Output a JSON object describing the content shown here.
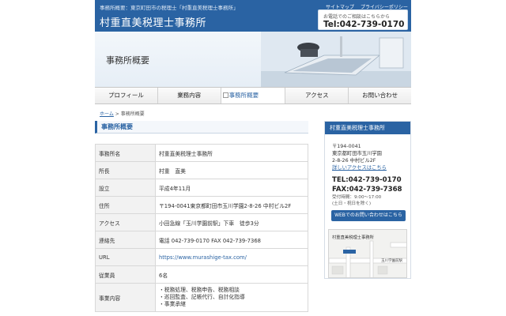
{
  "header": {
    "tagline": "事務所概要：東京町田市の税理士「村重直美税理士事務所」",
    "logo": "村重直美税理士事務所",
    "util_links": [
      "サイトマップ",
      "プライバシーポリシー"
    ],
    "contact_note": "お電話でのご相談はこちらから",
    "contact_tel": "Tel:042-739-0170"
  },
  "banner": {
    "title": "事務所概要"
  },
  "nav": {
    "items": [
      {
        "label": "プロフィール"
      },
      {
        "label": "業務内容"
      },
      {
        "label": "事務所概要"
      },
      {
        "label": "アクセス"
      },
      {
        "label": "お問い合わせ"
      }
    ]
  },
  "breadcrumb": {
    "home": "ホーム",
    "separator": ">",
    "current": "事務所概要"
  },
  "main": {
    "section_title": "事務所概要",
    "rows": [
      {
        "key": "事務所名",
        "value": "村重直美税理士事務所"
      },
      {
        "key": "所長",
        "value": "村重　直美"
      },
      {
        "key": "設立",
        "value": "平成4年11月"
      },
      {
        "key": "住所",
        "value": "〒194-0041東京都町田市玉川学園2-8-26 中村ビル2F"
      },
      {
        "key": "アクセス",
        "value": "小田急線「玉川学園前駅」下車　徒歩3分"
      },
      {
        "key": "連絡先",
        "value": "電話 042-739-0170 FAX 042-739-7368"
      },
      {
        "key": "URL",
        "value": "https://www.murashige-tax.com/"
      },
      {
        "key": "従業員",
        "value": "6名"
      }
    ],
    "business": {
      "key": "事業内容",
      "items": [
        "税務処理、税務申告、税務相談",
        "巡回監査、記帳代行、自計化指導",
        "事業承継"
      ]
    }
  },
  "sidebar": {
    "title": "村重直美税理士事務所",
    "postal": "〒194-0041",
    "address_1": "東京都町田市玉川学園",
    "address_2": "2-8-26 中村ビル2F",
    "access_link": "詳しいアクセスはこちら",
    "tel": "TEL:042-739-0170",
    "fax": "FAX:042-739-7368",
    "hours": "受付時間：9:00～17:00",
    "closed": "(土日・祝日を除く)",
    "web_button": "WEBでのお問い合わせはこちら",
    "map_label": "村重直美税理士事務所",
    "map_road": "玉川学園前駅"
  },
  "colors": {
    "primary": "#2a63a3",
    "row_key_bg": "#f2f2f2",
    "border": "#d8d8d8"
  }
}
